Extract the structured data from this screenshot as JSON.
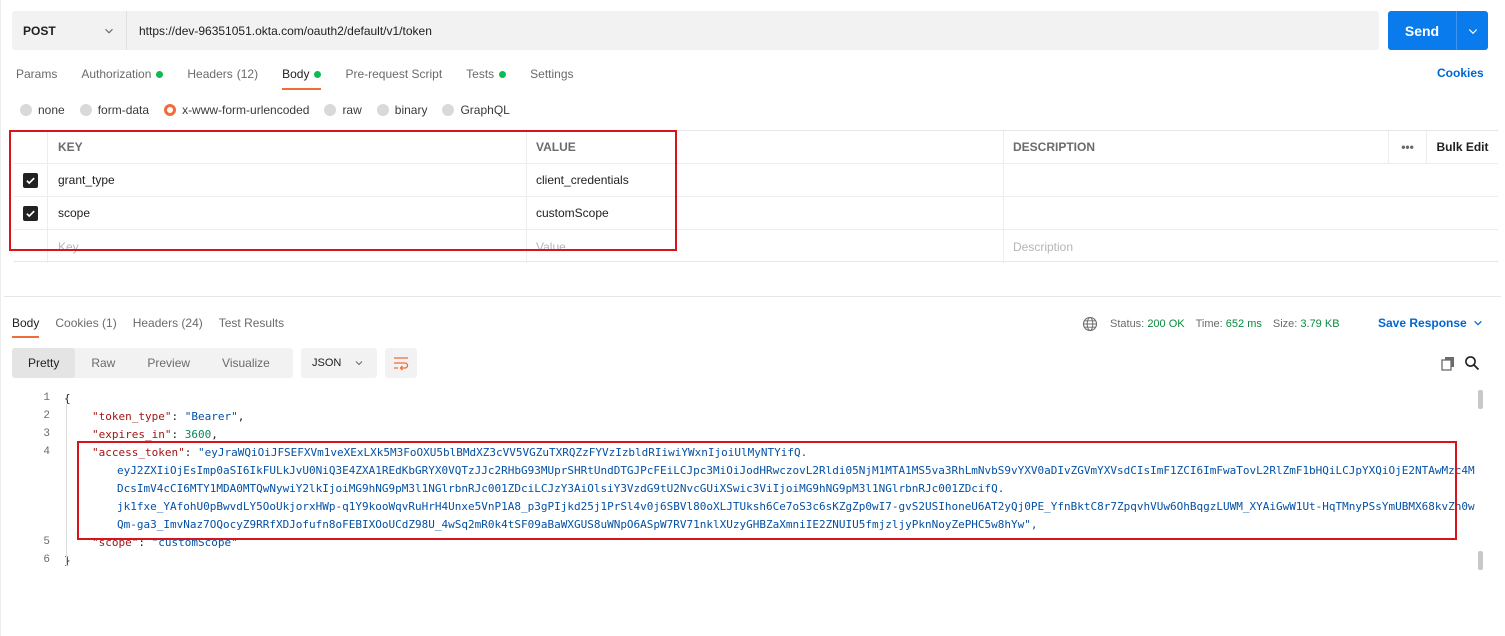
{
  "request": {
    "method": "POST",
    "url": "https://dev-96351051.okta.com/oauth2/default/v1/token",
    "send_label": "Send"
  },
  "tabs": [
    {
      "label": "Params",
      "count": "",
      "dot": false,
      "active": false
    },
    {
      "label": "Authorization",
      "count": "",
      "dot": true,
      "active": false
    },
    {
      "label": "Headers",
      "count": "(12)",
      "dot": false,
      "active": false
    },
    {
      "label": "Body",
      "count": "",
      "dot": true,
      "active": true
    },
    {
      "label": "Pre-request Script",
      "count": "",
      "dot": false,
      "active": false
    },
    {
      "label": "Tests",
      "count": "",
      "dot": true,
      "active": false
    },
    {
      "label": "Settings",
      "count": "",
      "dot": false,
      "active": false
    }
  ],
  "cookies_label": "Cookies",
  "body_types": [
    {
      "label": "none",
      "selected": false
    },
    {
      "label": "form-data",
      "selected": false
    },
    {
      "label": "x-www-form-urlencoded",
      "selected": true
    },
    {
      "label": "raw",
      "selected": false
    },
    {
      "label": "binary",
      "selected": false
    },
    {
      "label": "GraphQL",
      "selected": false
    }
  ],
  "params_table": {
    "headers": {
      "key": "KEY",
      "value": "VALUE",
      "description": "DESCRIPTION",
      "more": "•••",
      "bulk_edit": "Bulk Edit"
    },
    "rows": [
      {
        "checked": true,
        "key": "grant_type",
        "value": "client_credentials",
        "description": ""
      },
      {
        "checked": true,
        "key": "scope",
        "value": "customScope",
        "description": ""
      }
    ],
    "placeholders": {
      "key": "Key",
      "value": "Value",
      "description": "Description"
    }
  },
  "response": {
    "tabs": [
      {
        "label": "Body",
        "active": true
      },
      {
        "label": "Cookies (1)",
        "active": false
      },
      {
        "label": "Headers (24)",
        "active": false
      },
      {
        "label": "Test Results",
        "active": false
      }
    ],
    "status_label": "Status:",
    "status_value": "200 OK",
    "time_label": "Time:",
    "time_value": "652 ms",
    "size_label": "Size:",
    "size_value": "3.79 KB",
    "save_label": "Save Response",
    "view_modes": [
      "Pretty",
      "Raw",
      "Preview",
      "Visualize"
    ],
    "active_view": "Pretty",
    "format": "JSON",
    "line_numbers": [
      "1",
      "2",
      "3",
      "4",
      "5",
      "6"
    ],
    "json": {
      "open": "{",
      "close": "}",
      "token_type_key": "\"token_type\"",
      "token_type_val": "\"Bearer\"",
      "expires_in_key": "\"expires_in\"",
      "expires_in_val": "3600",
      "access_token_key": "\"access_token\"",
      "access_token_lines": [
        "\"eyJraWQiOiJFSEFXVm1veXExLXk5M3FoOXU5blBMdXZ3cVV5VGZuTXRQZzFYVzIzbldRIiwiYWxnIjoiUlMyNTYifQ.",
        "eyJ2ZXIiOjEsImp0aSI6IkFULkJvU0NiQ3E4ZXA1REdKbGRYX0VQTzJJc2RHbG93MUprSHRtUndDTGJPcFEiLCJpc3MiOiJodHRwczovL2Rldi05NjM1MTA1MS5va3RhLmNvbS9vYXV0aDIvZGVmYXVsdCIsImF1ZCI6ImFwaTovL2RlZmF1bHQiLCJpYXQiOjE2NTAwMzc4M",
        "DcsImV4cCI6MTY1MDA0MTQwNywiY2lkIjoiMG9hNG9pM3l1NGlrbnRJc001ZDciLCJzY3AiOlsiY3VzdG9tU2NvcGUiXSwic3ViIjoiMG9hNG9pM3l1NGlrbnRJc001ZDcifQ.",
        "jk1fxe_YAfohU0pBwvdLY5OoUkjorxHWp-q1Y9kooWqvRuHrH4Unxe5VnP1A8_p3gPIjkd25j1PrSl4v0j6SBVl80oXLJTUksh6Ce7oS3c6sKZgZp0wI7-gvS2USIhoneU6AT2yQj0PE_YfnBktC8r7ZpqvhVUw6OhBqgzLUWM_XYAiGwW1Ut-HqTMnyPSsYmUBMX68kvZn0w",
        "Qm-ga3_ImvNaz7OQocyZ9RRfXDJofufn8oFEBIXOoUCdZ98U_4wSq2mR0k4tSF09aBaWXGUS8uWNpO6ASpW7RV71nklXUzyGHBZaXmniIE2ZNUIU5fmjzljyPknNoyZePHC5w8hYw\","
      ],
      "scope_key": "\"scope\"",
      "scope_val": "\"customScope\""
    }
  },
  "colors": {
    "accent": "#f26b3a",
    "send": "#097bed",
    "link": "#0265d2",
    "highlight": "#d7141c",
    "dot": "#0cbb52"
  }
}
